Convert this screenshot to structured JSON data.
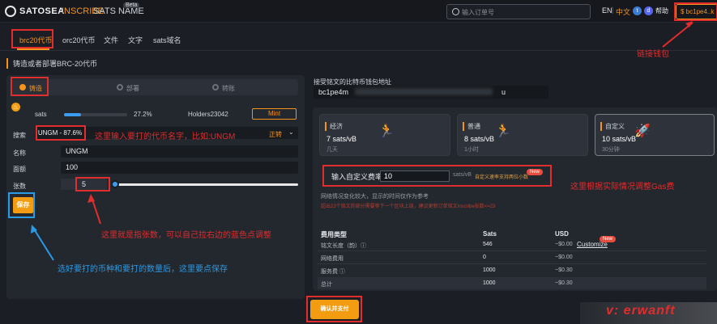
{
  "header": {
    "logo_text": "SATOSEA",
    "nav_inscribe": "INSCRIBE",
    "nav_sats_name": "SATS NAME",
    "beta_badge": "Beta",
    "search_placeholder": "输入订单号",
    "lang_en": "EN",
    "lang_sep": "|",
    "lang_zh": "中文",
    "help": "帮助",
    "wallet": "bc1pe4..k"
  },
  "tabs": [
    "brc20代币",
    "orc20代币",
    "文件",
    "文字",
    "sats域名"
  ],
  "subtitle": "铸造或者部署BRC-20代币",
  "mint_panel": {
    "options": [
      "铸造",
      "部署",
      "转账"
    ],
    "progress_label": "sats",
    "progress_pct": "27.2%",
    "progress_value": 0.272,
    "holders": "Holders23042",
    "mint_button": "Mint",
    "search_label": "搜索",
    "search_value": "UNGM - 87.6%",
    "zhuan": "正转",
    "name_label": "名称",
    "name_value": "UNGM",
    "amount_label": "面额",
    "amount_value": "100",
    "count_label": "张数",
    "count_value": "5",
    "slider_value": 0.02,
    "save_button": "保存"
  },
  "receive": {
    "label": "接受铭文的比特币钱包地址",
    "address_start": "bc1pe4m",
    "address_end": "u"
  },
  "fees": {
    "cards": [
      {
        "name": "经济",
        "rate": "7 sats/vB",
        "time": "几天"
      },
      {
        "name": "普通",
        "rate": "8 sats/vB",
        "time": "1小时"
      },
      {
        "name": "自定义",
        "rate": "10 sats/vB",
        "time": "30分钟"
      }
    ],
    "custom_label": "输入自定义费率",
    "custom_value": "10",
    "custom_unit": "sats/vB",
    "custom_note": "自定义速率支持两位小数",
    "new_badge": "New",
    "network_note": "网络情况变化较大，显示的时间仅作为参考",
    "network_note2": "超出23个铭文的部分需要等下一个区块上链，建议更新订单铭文Inscribe张数<=23"
  },
  "cost_table": {
    "headers": [
      "费用类型",
      "Sats",
      "USD"
    ],
    "rows": [
      {
        "type": "铭文长度（韵）ⓘ",
        "sats": "546",
        "usd": "~$0.00"
      },
      {
        "type": "网络费用",
        "sats": "0",
        "usd": "~$0.00"
      },
      {
        "type": "服务费 ⓘ",
        "sats": "1000",
        "usd": "~$0.30"
      },
      {
        "type": "总计",
        "sats": "1000",
        "usd": "~$0.30"
      }
    ],
    "customize": "Customize",
    "new_badge": "New"
  },
  "pay_button": "确认并支付",
  "annotations": {
    "wallet_note": "链接钱包",
    "token_note": "这里输入要打的代币名字，比如:UNGM",
    "gas_note": "这里根据实际情况调整Gas费",
    "slider_note": "这里就是指张数，可以自己拉右边的蓝色点调整",
    "save_note": "选好要打的币种和要打的数量后，这里要点保存",
    "watermark": "v: erwanft"
  },
  "colors": {
    "accent": "#f7931a",
    "annotation_red": "#e12d2d",
    "annotation_blue": "#2b9be6",
    "slider_blue": "#3b9cf2"
  }
}
